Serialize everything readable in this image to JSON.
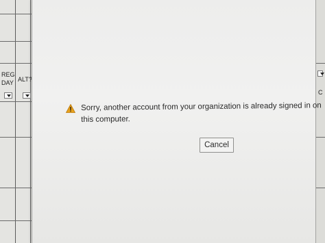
{
  "background_sheet": {
    "headers": [
      "REG",
      "DAY",
      "ALT?",
      "C"
    ]
  },
  "dialog": {
    "icon": "warning-icon",
    "message": "Sorry, another account from your organization is already signed in on this computer.",
    "cancel_label": "Cancel"
  },
  "colors": {
    "warning": "#e8a21c",
    "dialog_background": "#efefee"
  }
}
